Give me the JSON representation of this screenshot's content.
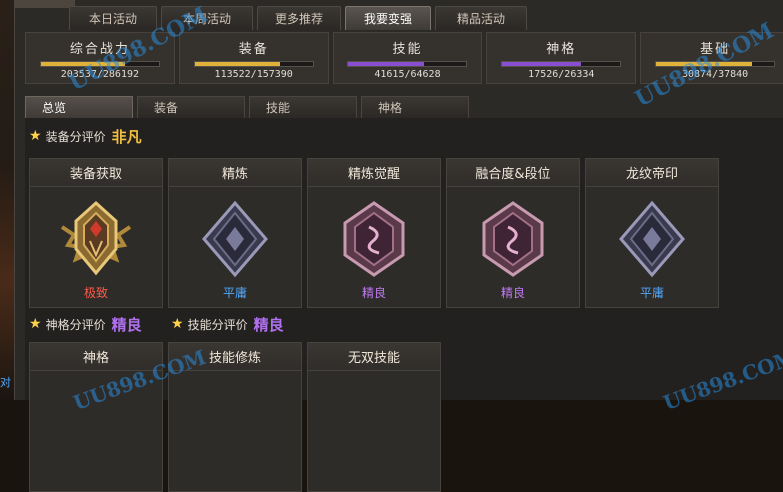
{
  "top_tabs": [
    {
      "label": "本日活动",
      "active": false
    },
    {
      "label": "本周活动",
      "active": false
    },
    {
      "label": "更多推荐",
      "active": false
    },
    {
      "label": "我要变强",
      "active": true
    },
    {
      "label": "精品活动",
      "active": false
    }
  ],
  "stats": [
    {
      "label": "综合战力",
      "value": "203537/286192",
      "progress": 0.711,
      "color": "#e0b23a"
    },
    {
      "label": "装备",
      "value": "113522/157390",
      "progress": 0.721,
      "color": "#e0b23a"
    },
    {
      "label": "技能",
      "value": "41615/64628",
      "progress": 0.644,
      "color": "#8a4fd0"
    },
    {
      "label": "神格",
      "value": "17526/26334",
      "progress": 0.666,
      "color": "#8a4fd0"
    },
    {
      "label": "基础",
      "value": "30874/37840",
      "progress": 0.816,
      "color": "#e0b23a"
    }
  ],
  "sub_tabs": [
    {
      "label": "总览",
      "active": true
    },
    {
      "label": "装备",
      "active": false
    },
    {
      "label": "技能",
      "active": false
    },
    {
      "label": "神格",
      "active": false
    }
  ],
  "equip_section": {
    "label": "装备分评价",
    "grade": "非凡",
    "grade_color": "#f0c040"
  },
  "godhood_section": {
    "label": "神格分评价",
    "grade": "精良",
    "grade_color": "#b070f0"
  },
  "skill_section": {
    "label": "技能分评价",
    "grade": "精良",
    "grade_color": "#b070f0"
  },
  "equip_cards": [
    {
      "title": "装备获取",
      "grade": "极致",
      "grade_color": "#ff5a4a",
      "icon": "gold-crest-icon"
    },
    {
      "title": "精炼",
      "grade": "平庸",
      "grade_color": "#4fa8ff",
      "icon": "silver-diamond-icon"
    },
    {
      "title": "精炼觉醒",
      "grade": "精良",
      "grade_color": "#c07af5",
      "icon": "purple-diamond-icon"
    },
    {
      "title": "融合度&段位",
      "grade": "精良",
      "grade_color": "#c07af5",
      "icon": "purple-diamond-icon"
    },
    {
      "title": "龙纹帝印",
      "grade": "平庸",
      "grade_color": "#4fa8ff",
      "icon": "silver-diamond-icon"
    }
  ],
  "lower_cards": [
    {
      "title": "神格"
    },
    {
      "title": "技能修炼"
    },
    {
      "title": "无双技能"
    }
  ],
  "watermark": "UU898.COM",
  "watermark_partial": "对"
}
